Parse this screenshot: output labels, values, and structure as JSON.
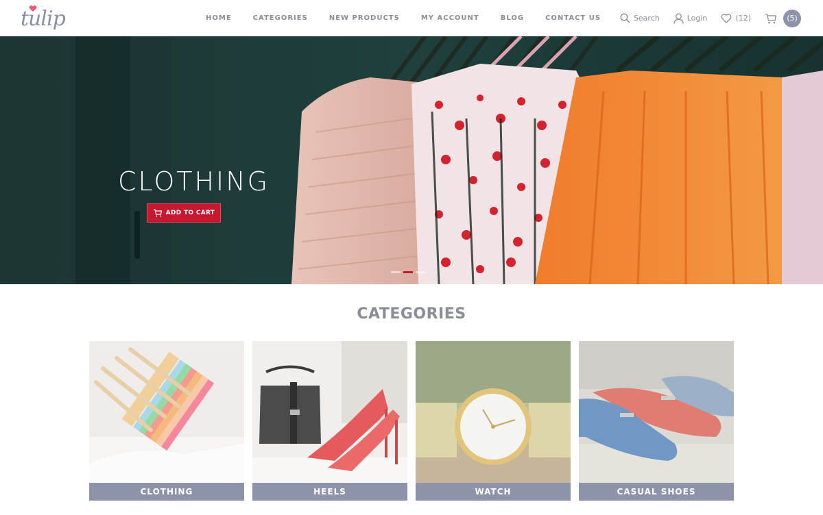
{
  "brand": {
    "name": "tulip"
  },
  "nav": [
    {
      "label": "HOME"
    },
    {
      "label": "CATEGORIES"
    },
    {
      "label": "NEW PRODUCTS"
    },
    {
      "label": "MY ACCOUNT"
    },
    {
      "label": "BLOG"
    },
    {
      "label": "CONTACT US"
    }
  ],
  "tools": {
    "search_label": "Search",
    "login_label": "Login",
    "wishlist_count": "(12)",
    "cart_count": "(5)"
  },
  "hero": {
    "title": "CLOTHING",
    "button_label": "ADD TO CART",
    "slides": 3,
    "active_slide": 2
  },
  "categories": {
    "heading": "CATEGORIES",
    "items": [
      {
        "label": "CLOTHING",
        "icon": "hangers-image"
      },
      {
        "label": "HEELS",
        "icon": "heels-image"
      },
      {
        "label": "WATCH",
        "icon": "watch-image"
      },
      {
        "label": "CASUAL SHOES",
        "icon": "shoes-image"
      }
    ]
  },
  "colors": {
    "accent": "#c8172e",
    "label_bg": "#8d93a9",
    "nav_text": "#8a8d96"
  }
}
